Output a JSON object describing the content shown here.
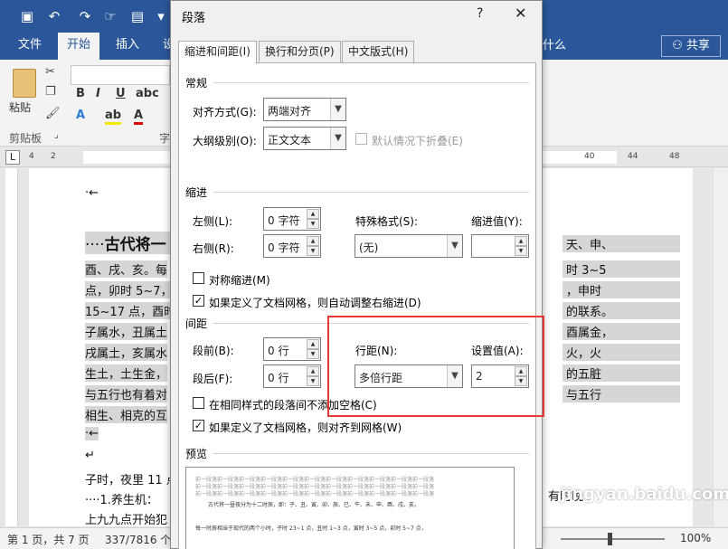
{
  "word": {
    "tabs": [
      "文件",
      "开始",
      "插入",
      "设"
    ],
    "active_tab": "开始",
    "tell_me": "什么",
    "share": "共享",
    "paste_label": "粘贴",
    "clipboard_group": "剪贴板",
    "font_group_partial": "字",
    "doc_lines": {
      "l1": "·←",
      "heading_prefix": "····",
      "heading": "古代将一",
      "l3": "酉、戌、亥。每",
      "l4": "点，卯时 5~7，",
      "l5": "15~17 点，酉时",
      "l6": "子属水，丑属土",
      "l7": "戌属土，亥属水",
      "l8": "生土，土生金，",
      "l9": "与五行也有着对",
      "l10": "相生、相克的互",
      "l11": "·←",
      "l12": "↵",
      "l13": "子时，夜里 11 点",
      "l14": "····1.养生机：",
      "l15": "上九九点开始犯"
    },
    "doc_right": [
      "天、申、",
      "时 3~5",
      "，申时",
      "的联系。",
      "酉属金，",
      "火，火",
      "的五脏",
      "与五行"
    ],
    "doc_right_tail": "有时晚",
    "status": {
      "page": "第 1 页，共 7 页",
      "words": "337/7816 个",
      "zoom": "100%"
    },
    "watermark": "jingyan.baidu.com"
  },
  "dialog": {
    "title": "段落",
    "help": "?",
    "close": "✕",
    "tabs": [
      "缩进和间距(I)",
      "换行和分页(P)",
      "中文版式(H)"
    ],
    "general": {
      "heading": "常规",
      "alignment_label": "对齐方式(G):",
      "alignment_value": "两端对齐",
      "outline_label": "大纲级别(O):",
      "outline_value": "正文文本",
      "collapse_label": "默认情况下折叠(E)"
    },
    "indent": {
      "heading": "缩进",
      "left_label": "左侧(L):",
      "left_value": "0 字符",
      "right_label": "右侧(R):",
      "right_value": "0 字符",
      "special_label": "特殊格式(S):",
      "special_value": "(无)",
      "indent_by_label": "缩进值(Y):",
      "indent_by_value": "",
      "mirror_label": "对称缩进(M)",
      "auto_adjust_label": "如果定义了文档网格，则自动调整右缩进(D)"
    },
    "spacing": {
      "heading": "间距",
      "before_label": "段前(B):",
      "before_value": "0 行",
      "after_label": "段后(F):",
      "after_value": "0 行",
      "line_spacing_label": "行距(N):",
      "line_spacing_value": "多倍行距",
      "at_label": "设置值(A):",
      "at_value": "2",
      "no_space_label": "在相同样式的段落间不添加空格(C)",
      "snap_grid_label": "如果定义了文档网格，则对齐到网格(W)"
    },
    "preview": {
      "heading": "预览",
      "prev_para": "前一段落前一段落前一段落前一段落前一段落前一段落前一段落前一段落前一段落前一段落前一段落",
      "sample1": "古代将一昼夜分为十二时辰，即：子、丑、寅、卯、辰、巳、午、未、申、酉、戌、亥。",
      "sample2": "每一时辰相当于现代的两个小时，子时 23~1 点，丑时 1~3 点，寅时 3~5 点，卯时 5~7 点，"
    }
  },
  "colors": {
    "word_blue": "#2b579a",
    "highlight_box": "#e53935"
  }
}
